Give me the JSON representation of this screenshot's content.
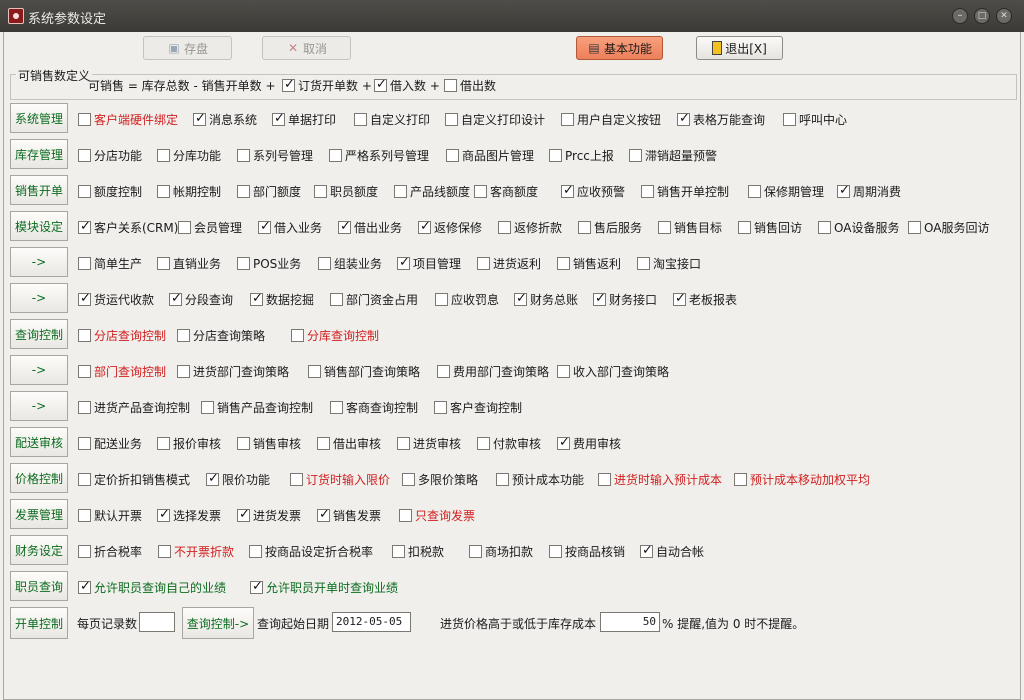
{
  "window": {
    "title": "系统参数设定"
  },
  "toolbar": {
    "save": "存盘",
    "cancel": "取消",
    "basic": "基本功能",
    "exit": "退出[X]"
  },
  "formula": {
    "legend": "可销售数定义",
    "text": "可销售 = 库存总数 - 销售开单数 +",
    "items": [
      {
        "label": "订货开单数 +",
        "checked": true
      },
      {
        "label": "借入数 +",
        "checked": true
      },
      {
        "label": "借出数",
        "checked": false
      }
    ]
  },
  "rows": [
    {
      "label": "系统管理",
      "items": [
        {
          "label": "客户端硬件绑定",
          "checked": false,
          "color": "red"
        },
        {
          "label": "消息系统",
          "checked": true
        },
        {
          "label": "单据打印",
          "checked": true
        },
        {
          "label": "自定义打印",
          "checked": false
        },
        {
          "label": "自定义打印设计",
          "checked": false
        },
        {
          "label": "用户自定义按钮",
          "checked": false
        },
        {
          "label": "表格万能查询",
          "checked": true
        },
        {
          "label": "呼叫中心",
          "checked": false
        }
      ]
    },
    {
      "label": "库存管理",
      "items": [
        {
          "label": "分店功能",
          "checked": false
        },
        {
          "label": "分库功能",
          "checked": false
        },
        {
          "label": "系列号管理",
          "checked": false
        },
        {
          "label": "严格系列号管理",
          "checked": false
        },
        {
          "label": "商品图片管理",
          "checked": false
        },
        {
          "label": "Prcc上报",
          "checked": false
        },
        {
          "label": "滞销超量预警",
          "checked": false
        }
      ]
    },
    {
      "label": "销售开单",
      "items": [
        {
          "label": "额度控制",
          "checked": false
        },
        {
          "label": "帐期控制",
          "checked": false
        },
        {
          "label": "部门额度",
          "checked": false
        },
        {
          "label": "职员额度",
          "checked": false
        },
        {
          "label": "产品线额度",
          "checked": false
        },
        {
          "label": "客商额度",
          "checked": false
        },
        {
          "label": "应收预警",
          "checked": true
        },
        {
          "label": "销售开单控制",
          "checked": false
        },
        {
          "label": "保修期管理",
          "checked": false
        },
        {
          "label": "周期消费",
          "checked": true
        }
      ]
    },
    {
      "label": "模块设定",
      "items": [
        {
          "label": "客户关系(CRM)",
          "checked": true
        },
        {
          "label": "会员管理",
          "checked": false
        },
        {
          "label": "借入业务",
          "checked": true
        },
        {
          "label": "借出业务",
          "checked": true
        },
        {
          "label": "返修保修",
          "checked": true
        },
        {
          "label": "返修折款",
          "checked": false
        },
        {
          "label": "售后服务",
          "checked": false
        },
        {
          "label": "销售目标",
          "checked": false
        },
        {
          "label": "销售回访",
          "checked": false
        },
        {
          "label": "OA设备服务",
          "checked": false
        },
        {
          "label": "OA服务回访",
          "checked": false
        }
      ]
    },
    {
      "label": "->",
      "items": [
        {
          "label": "简单生产",
          "checked": false
        },
        {
          "label": "直销业务",
          "checked": false
        },
        {
          "label": "POS业务",
          "checked": false
        },
        {
          "label": "组装业务",
          "checked": false
        },
        {
          "label": "项目管理",
          "checked": true
        },
        {
          "label": "进货返利",
          "checked": false
        },
        {
          "label": "销售返利",
          "checked": false
        },
        {
          "label": "淘宝接口",
          "checked": false
        }
      ]
    },
    {
      "label": "->",
      "items": [
        {
          "label": "货运代收款",
          "checked": true
        },
        {
          "label": "分段查询",
          "checked": true
        },
        {
          "label": "数据挖掘",
          "checked": true
        },
        {
          "label": "部门资金占用",
          "checked": false
        },
        {
          "label": "应收罚息",
          "checked": false
        },
        {
          "label": "财务总账",
          "checked": true
        },
        {
          "label": "财务接口",
          "checked": true
        },
        {
          "label": "老板报表",
          "checked": true
        }
      ]
    },
    {
      "label": "查询控制",
      "items": [
        {
          "label": "分店查询控制",
          "checked": false,
          "color": "red"
        },
        {
          "label": "分店查询策略",
          "checked": false
        },
        {
          "label": "分库查询控制",
          "checked": false,
          "color": "red"
        }
      ]
    },
    {
      "label": "->",
      "items": [
        {
          "label": "部门查询控制",
          "checked": false,
          "color": "red"
        },
        {
          "label": "进货部门查询策略",
          "checked": false
        },
        {
          "label": "销售部门查询策略",
          "checked": false
        },
        {
          "label": "费用部门查询策略",
          "checked": false
        },
        {
          "label": "收入部门查询策略",
          "checked": false
        }
      ]
    },
    {
      "label": "->",
      "items": [
        {
          "label": "进货产品查询控制",
          "checked": false
        },
        {
          "label": "销售产品查询控制",
          "checked": false
        },
        {
          "label": "客商查询控制",
          "checked": false
        },
        {
          "label": "客户查询控制",
          "checked": false
        }
      ]
    },
    {
      "label": "配送审核",
      "items": [
        {
          "label": "配送业务",
          "checked": false
        },
        {
          "label": "报价审核",
          "checked": false
        },
        {
          "label": "销售审核",
          "checked": false
        },
        {
          "label": "借出审核",
          "checked": false
        },
        {
          "label": "进货审核",
          "checked": false
        },
        {
          "label": "付款审核",
          "checked": false
        },
        {
          "label": "费用审核",
          "checked": true
        }
      ]
    },
    {
      "label": "价格控制",
      "items": [
        {
          "label": "定价折扣销售模式",
          "checked": false
        },
        {
          "label": "限价功能",
          "checked": true
        },
        {
          "label": "订货时输入限价",
          "checked": false,
          "color": "red"
        },
        {
          "label": "多限价策略",
          "checked": false
        },
        {
          "label": "预计成本功能",
          "checked": false
        },
        {
          "label": "进货时输入预计成本",
          "checked": false,
          "color": "red"
        },
        {
          "label": "预计成本移动加权平均",
          "checked": false,
          "color": "red"
        }
      ]
    },
    {
      "label": "发票管理",
      "items": [
        {
          "label": "默认开票",
          "checked": false
        },
        {
          "label": "选择发票",
          "checked": true
        },
        {
          "label": "进货发票",
          "checked": true
        },
        {
          "label": "销售发票",
          "checked": true
        },
        {
          "label": "只查询发票",
          "checked": false,
          "color": "red"
        }
      ]
    },
    {
      "label": "财务设定",
      "items": [
        {
          "label": "折合税率",
          "checked": false
        },
        {
          "label": "不开票折款",
          "checked": false,
          "color": "red"
        },
        {
          "label": "按商品设定折合税率",
          "checked": false
        },
        {
          "label": "扣税款",
          "checked": false
        },
        {
          "label": "商场扣款",
          "checked": false
        },
        {
          "label": "按商品核销",
          "checked": false
        },
        {
          "label": "自动合帐",
          "checked": true
        }
      ]
    },
    {
      "label": "职员查询",
      "items": [
        {
          "label": "允许职员查询自己的业绩",
          "checked": true,
          "color": "green"
        },
        {
          "label": "允许职员开单时查询业绩",
          "checked": true,
          "color": "green"
        }
      ]
    }
  ],
  "last_row": {
    "label": "开单控制",
    "per_page_label": "每页记录数",
    "per_page_value": "",
    "query_button": "查询控制->",
    "start_date_label": "查询起始日期",
    "start_date": "2012-05-05",
    "price_warn_label": "进货价格高于或低于库存成本",
    "price_warn_value": "50",
    "price_warn_suffix": "% 提醒,值为 0 时不提醒。"
  }
}
